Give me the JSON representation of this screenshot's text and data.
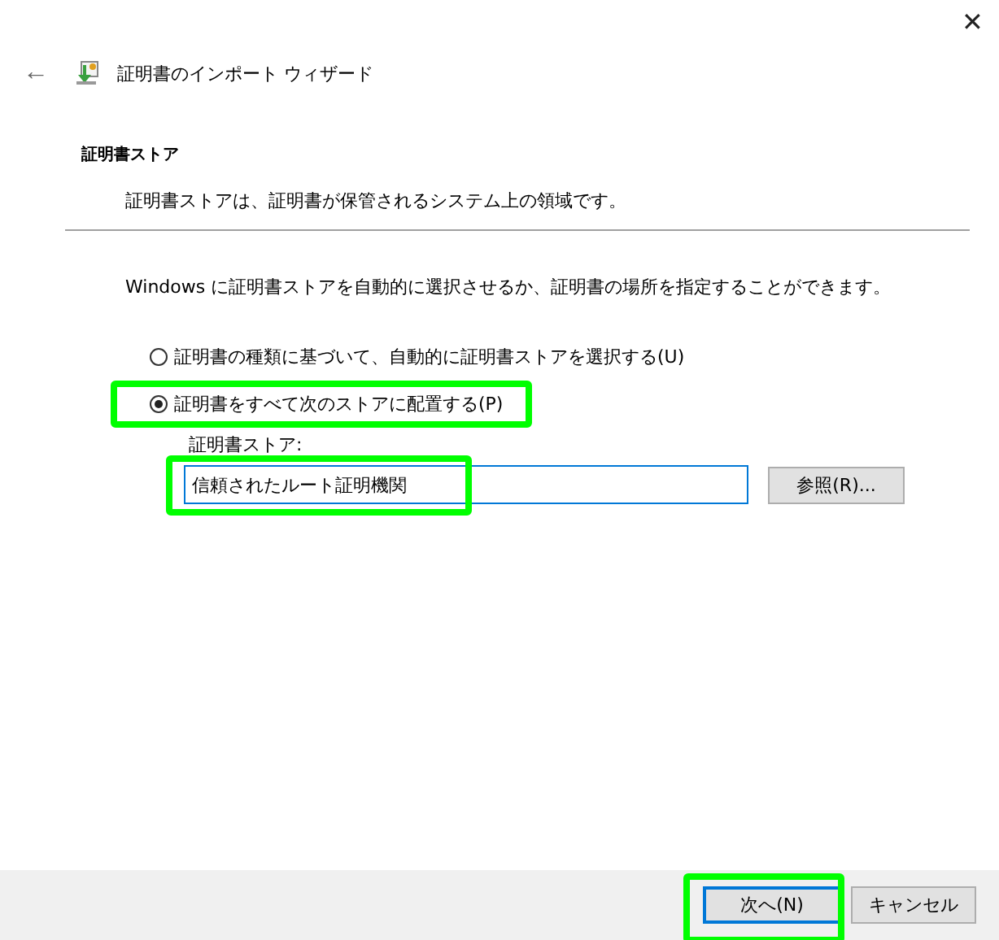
{
  "window": {
    "close": "✕",
    "back": "←",
    "title": "証明書のインポート ウィザード"
  },
  "section": {
    "heading": "証明書ストア",
    "description": "証明書ストアは、証明書が保管されるシステム上の領域です。"
  },
  "instruction": "Windows に証明書ストアを自動的に選択させるか、証明書の場所を指定することができます。",
  "options": [
    {
      "label": "証明書の種類に基づいて、自動的に証明書ストアを選択する(U)",
      "selected": false,
      "highlighted": false
    },
    {
      "label": "証明書をすべて次のストアに配置する(P)",
      "selected": true,
      "highlighted": true
    }
  ],
  "store": {
    "label": "証明書ストア:",
    "value": "信頼されたルート証明機関",
    "highlighted": true,
    "browse_button": "参照(R)..."
  },
  "buttons": [
    {
      "label": "次へ(N)",
      "default": true,
      "highlighted": true
    },
    {
      "label": "キャンセル",
      "default": false,
      "highlighted": false
    }
  ]
}
